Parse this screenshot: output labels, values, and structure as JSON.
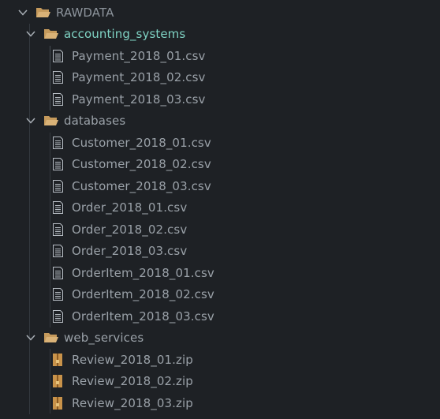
{
  "colors": {
    "background": "#1e2125",
    "label": "#9aa1a8",
    "active_folder_label": "#7fd3c4",
    "folder_icon": "#d9b277",
    "zip_icon": "#c9934a",
    "indent_guide": "#33383e"
  },
  "tree": {
    "root": {
      "label": "RAWDATA",
      "expanded": true,
      "icon": "folder-open-icon"
    },
    "folders": [
      {
        "label": "accounting_systems",
        "expanded": true,
        "active": true,
        "icon": "folder-open-icon",
        "files": [
          {
            "label": "Payment_2018_01.csv",
            "icon": "file-text-icon"
          },
          {
            "label": "Payment_2018_02.csv",
            "icon": "file-text-icon"
          },
          {
            "label": "Payment_2018_03.csv",
            "icon": "file-text-icon"
          }
        ]
      },
      {
        "label": "databases",
        "expanded": true,
        "active": false,
        "icon": "folder-open-icon",
        "files": [
          {
            "label": "Customer_2018_01.csv",
            "icon": "file-text-icon"
          },
          {
            "label": "Customer_2018_02.csv",
            "icon": "file-text-icon"
          },
          {
            "label": "Customer_2018_03.csv",
            "icon": "file-text-icon"
          },
          {
            "label": "Order_2018_01.csv",
            "icon": "file-text-icon"
          },
          {
            "label": "Order_2018_02.csv",
            "icon": "file-text-icon"
          },
          {
            "label": "Order_2018_03.csv",
            "icon": "file-text-icon"
          },
          {
            "label": "OrderItem_2018_01.csv",
            "icon": "file-text-icon"
          },
          {
            "label": "OrderItem_2018_02.csv",
            "icon": "file-text-icon"
          },
          {
            "label": "OrderItem_2018_03.csv",
            "icon": "file-text-icon"
          }
        ]
      },
      {
        "label": "web_services",
        "expanded": true,
        "active": false,
        "icon": "folder-open-icon",
        "files": [
          {
            "label": "Review_2018_01.zip",
            "icon": "file-zip-icon"
          },
          {
            "label": "Review_2018_02.zip",
            "icon": "file-zip-icon"
          },
          {
            "label": "Review_2018_03.zip",
            "icon": "file-zip-icon"
          }
        ]
      }
    ]
  }
}
